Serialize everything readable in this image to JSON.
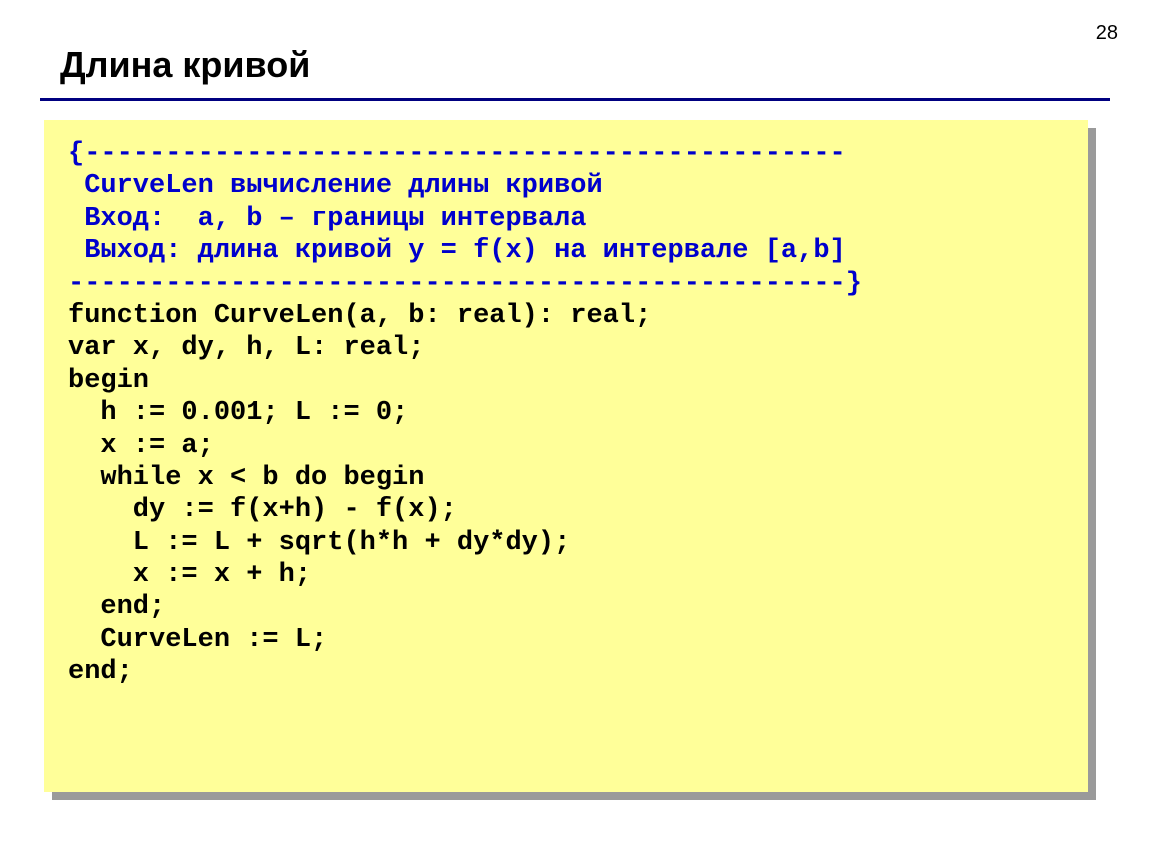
{
  "page_number": "28",
  "title": "Длина кривой",
  "code": {
    "c1": "{-----------------------------------------------",
    "c2": " CurveLen вычисление длины кривой",
    "c3": " Вход:  a, b – границы интервала",
    "c4": " Выход: длина кривой y = f(x) на интервале [a,b]",
    "c5": "------------------------------------------------}",
    "l1": "function CurveLen(a, b: real): real;",
    "l2": "var x, dy, h, L: real;",
    "l3": "begin",
    "l4": "  h := 0.001; L := 0;",
    "l5": "  x := a;",
    "l6": "  while x < b do begin",
    "l7": "    dy := f(x+h) - f(x);",
    "l8": "    L := L + sqrt(h*h + dy*dy);",
    "l9": "    x := x + h;",
    "l10": "  end;",
    "l11": "  CurveLen := L;",
    "l12": "end;"
  }
}
